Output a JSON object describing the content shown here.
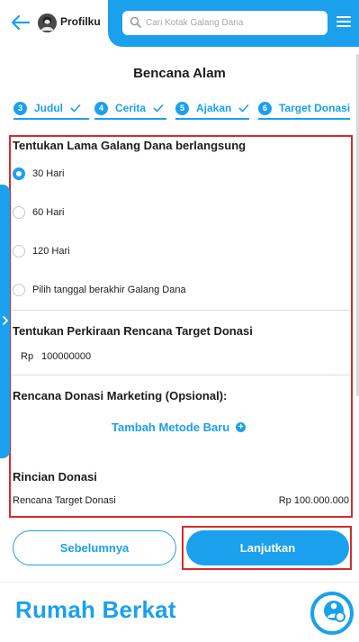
{
  "header": {
    "profile_label": "Profilku",
    "search_placeholder": "Cari Kotak Galang Dana"
  },
  "category_title": "Bencana Alam",
  "steps": [
    {
      "number": "3",
      "label": "Judul",
      "done": true
    },
    {
      "number": "4",
      "label": "Cerita",
      "done": true
    },
    {
      "number": "5",
      "label": "Ajakan",
      "done": true
    },
    {
      "number": "6",
      "label": "Target Donasi",
      "done": false
    }
  ],
  "duration": {
    "title": "Tentukan Lama Galang Dana berlangsung",
    "selected": "30 Hari",
    "options": [
      "30 Hari",
      "60 Hari",
      "120 Hari",
      "Pilih tanggal berakhir Galang Dana"
    ]
  },
  "target": {
    "title": "Tentukan Perkiraan Rencana Target Donasi",
    "currency": "Rp",
    "value": "100000000"
  },
  "marketing": {
    "title": "Rencana Donasi Marketing (Opsional):",
    "add_method_label": "Tambah Metode Baru"
  },
  "summary": {
    "title": "Rincian Donasi",
    "row_label": "Rencana Target Donasi",
    "row_value": "Rp 100.000.000"
  },
  "buttons": {
    "prev_label": "Sebelumnya",
    "next_label": "Lanjutkan"
  },
  "footer": {
    "brand": "Rumah Berkat"
  },
  "colors": {
    "accent": "#1ba0ee",
    "highlight_border": "#d62b2b"
  }
}
